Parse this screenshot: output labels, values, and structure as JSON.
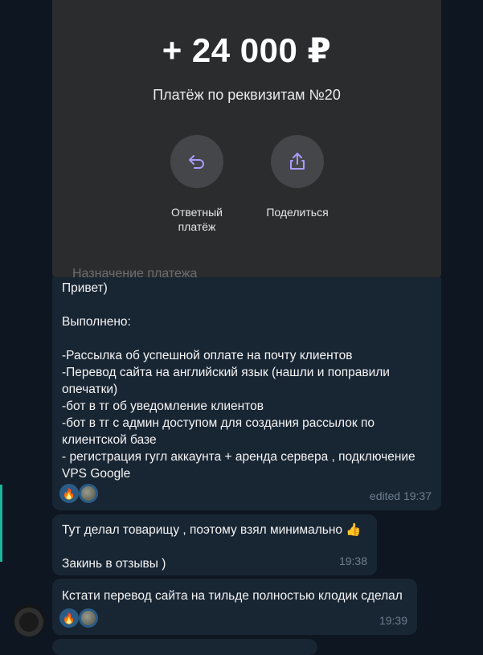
{
  "payment": {
    "amount": "+ 24 000 ₽",
    "title": "Платёж по реквизитам №20",
    "actions": [
      {
        "label": "Ответный\nплатёж",
        "icon": "undo-arrow-icon"
      },
      {
        "label": "Поделиться",
        "icon": "share-icon"
      }
    ],
    "purpose_label": "Назначение платежа"
  },
  "messages": [
    {
      "text": "Привет)\n\nВыполнено:\n\n-Рассылка об успешной оплате на почту клиентов\n-Перевод сайта на английский язык (нашли и поправили опечатки)\n-бот в тг об уведомление клиентов\n-бот в тг с админ доступом для создания рассылок по клиентской базе\n- регистрация гугл аккаунта + аренда сервера , подключение VPS Google",
      "reaction": "🔥",
      "time": "edited 19:37"
    },
    {
      "text": "Тут делал товарищу , поэтому взял минимально 👍\n\nЗакинь в отзывы )",
      "time": "19:38"
    },
    {
      "text": "Кстати перевод сайта на тильде полностью клодик сделал",
      "reaction": "🔥",
      "time": "19:39"
    }
  ],
  "colors": {
    "background": "#0e1621",
    "bubble": "#182533",
    "accent_icon": "#a99bff",
    "reaction_bg": "#2a5b85"
  }
}
